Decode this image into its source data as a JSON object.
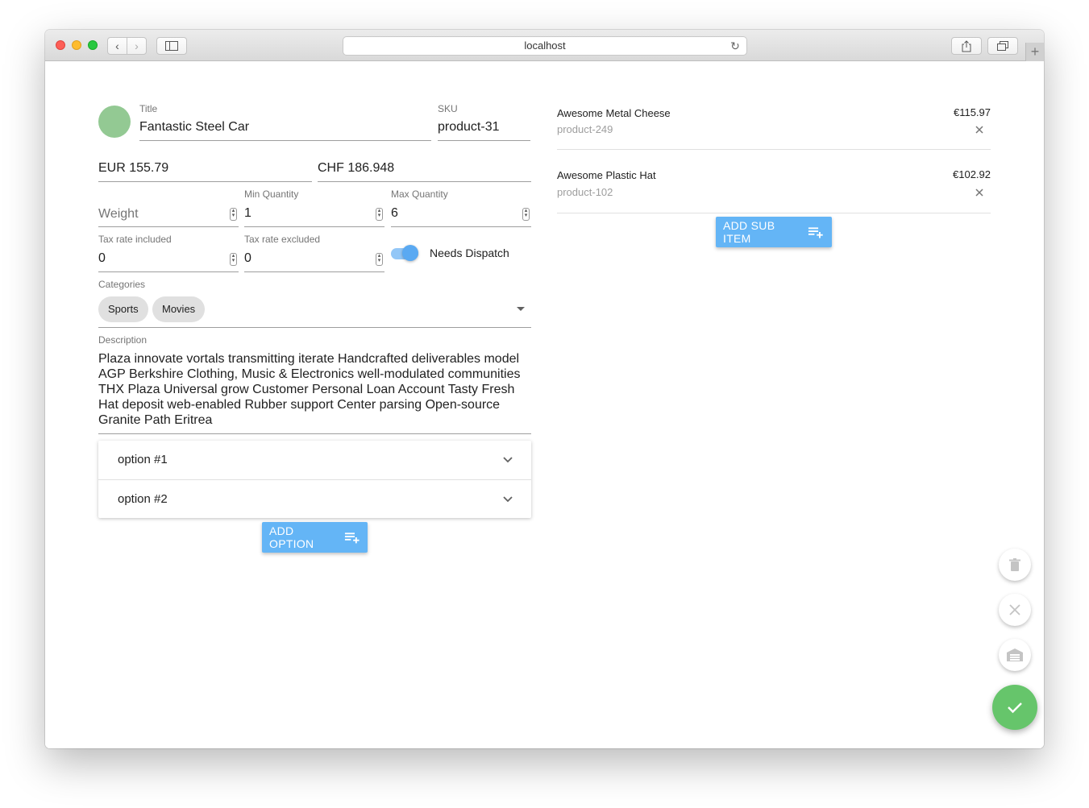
{
  "browser": {
    "address": "localhost"
  },
  "product": {
    "title_label": "Title",
    "title_value": "Fantastic Steel Car",
    "sku_label": "SKU",
    "sku_value": "product-31",
    "price_eur": "EUR 155.79",
    "price_chf": "CHF 186.948",
    "weight_placeholder": "Weight",
    "min_qty_label": "Min Quantity",
    "min_qty_value": "1",
    "max_qty_label": "Max Quantity",
    "max_qty_value": "6",
    "tax_incl_label": "Tax rate included",
    "tax_incl_value": "0",
    "tax_excl_label": "Tax rate excluded",
    "tax_excl_value": "0",
    "needs_dispatch_label": "Needs Dispatch",
    "needs_dispatch": true,
    "categories_label": "Categories",
    "categories": [
      "Sports",
      "Movies"
    ],
    "description_label": "Description",
    "description": "Plaza innovate vortals transmitting iterate Handcrafted deliverables model AGP Berkshire Clothing, Music & Electronics well-modulated communities THX Plaza Universal grow Customer Personal Loan Account Tasty Fresh Hat deposit web-enabled Rubber support Center parsing Open-source Granite Path Eritrea"
  },
  "options": [
    {
      "label": "option #1"
    },
    {
      "label": "option #2"
    }
  ],
  "add_option_label": "ADD OPTION",
  "sub_items": [
    {
      "name": "Awesome Metal Cheese",
      "sku": "product-249",
      "price": "€115.97"
    },
    {
      "name": "Awesome Plastic Hat",
      "sku": "product-102",
      "price": "€102.92"
    }
  ],
  "add_sub_item_label": "ADD SUB ITEM",
  "colors": {
    "accent": "#64b5f6",
    "toggle": "#5aa9f2",
    "save": "#66c56b",
    "avatar": "#93c993"
  }
}
